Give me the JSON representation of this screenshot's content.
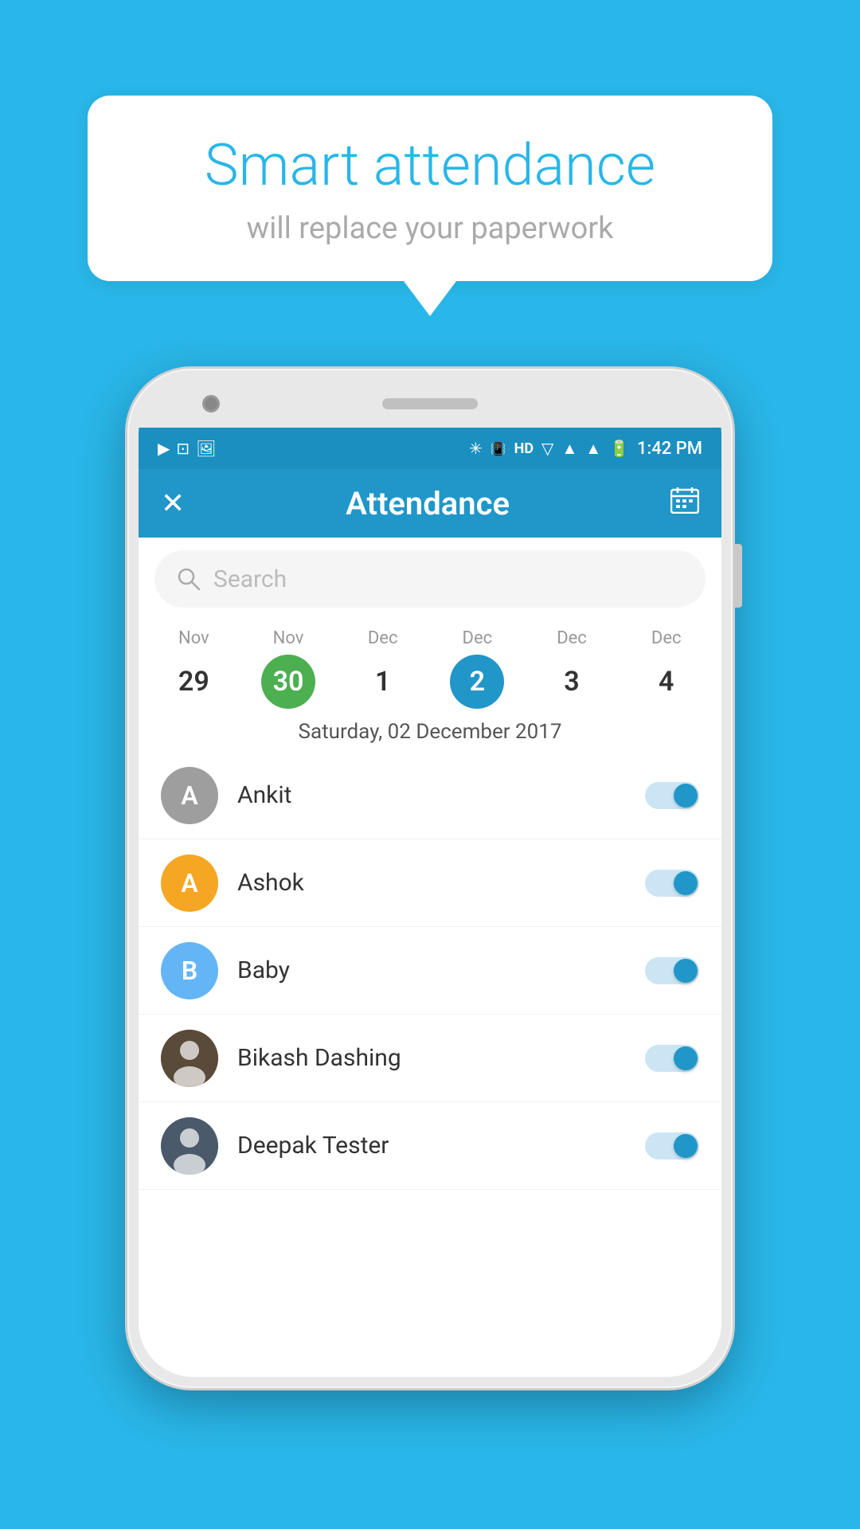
{
  "bubble": {
    "title": "Smart attendance",
    "subtitle": "will replace your paperwork"
  },
  "status_bar": {
    "time": "1:42 PM",
    "icons_left": [
      "▶",
      "⊡",
      "🖼"
    ],
    "icons_right": [
      "❄",
      "HD",
      "▼",
      "▲",
      "▲",
      "🔋"
    ]
  },
  "header": {
    "title": "Attendance",
    "close_label": "✕",
    "calendar_label": "📅"
  },
  "search": {
    "placeholder": "Search"
  },
  "calendar": {
    "days": [
      {
        "month": "Nov",
        "date": "29",
        "style": "normal"
      },
      {
        "month": "Nov",
        "date": "30",
        "style": "green"
      },
      {
        "month": "Dec",
        "date": "1",
        "style": "normal"
      },
      {
        "month": "Dec",
        "date": "2",
        "style": "blue"
      },
      {
        "month": "Dec",
        "date": "3",
        "style": "normal"
      },
      {
        "month": "Dec",
        "date": "4",
        "style": "normal"
      }
    ]
  },
  "selected_date": "Saturday, 02 December 2017",
  "attendance_list": [
    {
      "id": "ankit",
      "initial": "A",
      "name": "Ankit",
      "avatar_type": "initial",
      "avatar_color": "gray",
      "toggle_on": true
    },
    {
      "id": "ashok",
      "initial": "A",
      "name": "Ashok",
      "avatar_type": "initial",
      "avatar_color": "orange",
      "toggle_on": true
    },
    {
      "id": "baby",
      "initial": "B",
      "name": "Baby",
      "avatar_type": "initial",
      "avatar_color": "lightblue",
      "toggle_on": true
    },
    {
      "id": "bikash",
      "initial": "",
      "name": "Bikash Dashing",
      "avatar_type": "photo",
      "avatar_color": "dark",
      "toggle_on": true
    },
    {
      "id": "deepak",
      "initial": "",
      "name": "Deepak Tester",
      "avatar_type": "photo",
      "avatar_color": "dark2",
      "toggle_on": true
    }
  ]
}
